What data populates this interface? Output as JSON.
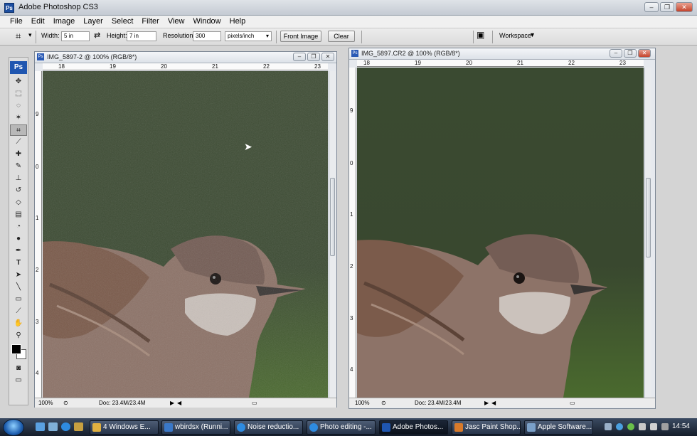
{
  "app": {
    "title": "Adobe Photoshop CS3",
    "logo": "Ps"
  },
  "menu": [
    "File",
    "Edit",
    "Image",
    "Layer",
    "Select",
    "Filter",
    "View",
    "Window",
    "Help"
  ],
  "options": {
    "width_label": "Width:",
    "width_value": "5 in",
    "height_label": "Height:",
    "height_value": "7 in",
    "resolution_label": "Resolution:",
    "resolution_value": "300",
    "units": "pixels/inch",
    "front_image": "Front Image",
    "clear": "Clear",
    "workspace": "Workspace"
  },
  "toolbox": {
    "logo": "Ps"
  },
  "documents": [
    {
      "title": "IMG_5897-2 @ 100% (RGB/8*)",
      "ruler_top": [
        "18",
        "19",
        "20",
        "21",
        "22",
        "23"
      ],
      "ruler_left": [
        "9",
        "0",
        "1",
        "2",
        "3",
        "4"
      ],
      "zoom": "100%",
      "doc": "Doc: 23.4M/23.4M"
    },
    {
      "title": "IMG_5897.CR2 @ 100% (RGB/8*)",
      "ruler_top": [
        "18",
        "19",
        "20",
        "21",
        "22",
        "23"
      ],
      "ruler_left": [
        "9",
        "0",
        "1",
        "2",
        "3",
        "4"
      ],
      "zoom": "100%",
      "doc": "Doc: 23.4M/23.4M"
    }
  ],
  "taskbar": {
    "items": [
      {
        "label": "4 Windows E...",
        "color": "#e0b040"
      },
      {
        "label": "wbirdsx (Runni...",
        "color": "#3a78c8"
      },
      {
        "label": "Noise reductio...",
        "color": "#2e8be0"
      },
      {
        "label": "Photo editing -...",
        "color": "#2e8be0"
      },
      {
        "label": "Adobe Photos...",
        "color": "#1f56b0"
      },
      {
        "label": "Jasc Paint Shop...",
        "color": "#d87a2a"
      },
      {
        "label": "Apple Software...",
        "color": "#7aa0c8"
      }
    ],
    "clock": "14:54"
  }
}
